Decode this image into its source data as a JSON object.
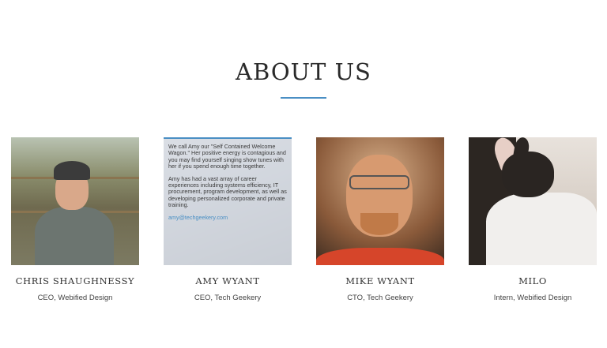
{
  "section": {
    "title": "ABOUT US"
  },
  "team": [
    {
      "name": "CHRIS SHAUGHNESSY",
      "role": "CEO, Webified Design"
    },
    {
      "name": "AMY WYANT",
      "role": "CEO, Tech Geekery",
      "bio_paragraph_1": "We call Amy our \"Self Contained Welcome Wagon.\" Her positive energy is contagious and you may find yourself singing show tunes with her if you spend enough time together.",
      "bio_paragraph_2": "Amy has had a vast array of career experiences including systems efficiency, IT procurement, program development, as well as developing personalized corporate and private training.",
      "email": "amy@techgeekery.com"
    },
    {
      "name": "MIKE WYANT",
      "role": "CTO, Tech Geekery"
    },
    {
      "name": "MILO",
      "role": "Intern, Webified Design"
    }
  ],
  "colors": {
    "accent": "#4a8fc4",
    "title_text": "#2a2a2a"
  }
}
